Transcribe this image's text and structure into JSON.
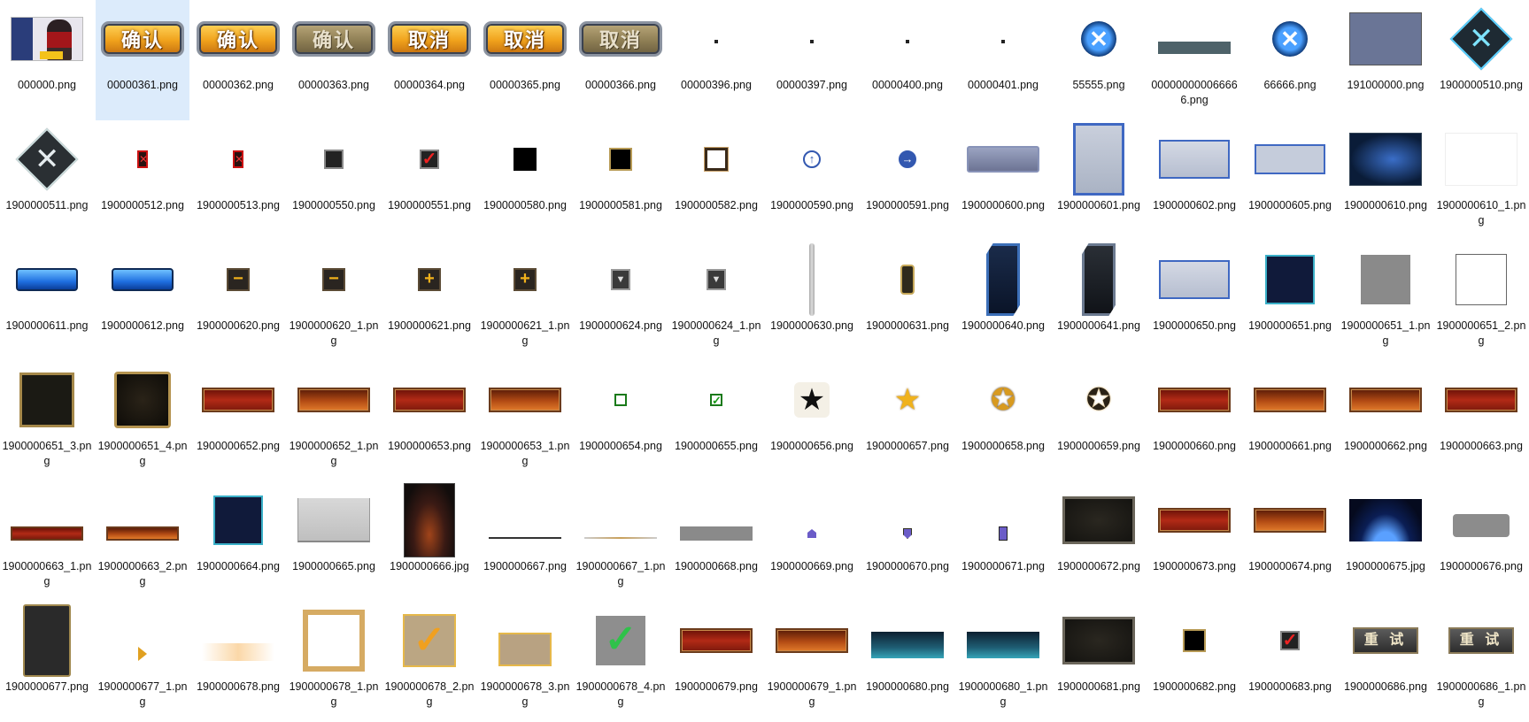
{
  "selected_index": 1,
  "files": [
    {
      "name": "000000.png",
      "icon": "character-avatar"
    },
    {
      "name": "00000361.png",
      "icon": "confirm-button-gold",
      "text": "确认"
    },
    {
      "name": "00000362.png",
      "icon": "confirm-button-gold",
      "text": "确认"
    },
    {
      "name": "00000363.png",
      "icon": "confirm-button-disabled",
      "text": "确认"
    },
    {
      "name": "00000364.png",
      "icon": "cancel-button-gold",
      "text": "取消"
    },
    {
      "name": "00000365.png",
      "icon": "cancel-button-gold",
      "text": "取消"
    },
    {
      "name": "00000366.png",
      "icon": "cancel-button-disabled",
      "text": "取消"
    },
    {
      "name": "00000396.png",
      "icon": "tiny-dot"
    },
    {
      "name": "00000397.png",
      "icon": "tiny-dot"
    },
    {
      "name": "00000400.png",
      "icon": "tiny-dot"
    },
    {
      "name": "00000401.png",
      "icon": "tiny-dot"
    },
    {
      "name": "55555.png",
      "icon": "blue-close-icon"
    },
    {
      "name": "000000000066666.png",
      "icon": "slate-bar"
    },
    {
      "name": "66666.png",
      "icon": "blue-close-icon"
    },
    {
      "name": "191000000.png",
      "icon": "slate-panel"
    },
    {
      "name": "1900000510.png",
      "icon": "diamond-close-icon"
    },
    {
      "name": "1900000511.png",
      "icon": "diamond-close-dark-icon"
    },
    {
      "name": "1900000512.png",
      "icon": "red-x-small"
    },
    {
      "name": "1900000513.png",
      "icon": "red-x-small"
    },
    {
      "name": "1900000550.png",
      "icon": "checkbox-empty"
    },
    {
      "name": "1900000551.png",
      "icon": "checkbox-checked-red"
    },
    {
      "name": "1900000580.png",
      "icon": "black-square"
    },
    {
      "name": "1900000581.png",
      "icon": "black-square-gold"
    },
    {
      "name": "1900000582.png",
      "icon": "white-square-frame"
    },
    {
      "name": "1900000590.png",
      "icon": "arrow-up-circle-icon"
    },
    {
      "name": "1900000591.png",
      "icon": "arrow-right-circle-icon"
    },
    {
      "name": "1900000600.png",
      "icon": "slate-bevel-bar"
    },
    {
      "name": "1900000601.png",
      "icon": "light-panel-tall"
    },
    {
      "name": "1900000602.png",
      "icon": "light-panel"
    },
    {
      "name": "1900000605.png",
      "icon": "light-panel-flat"
    },
    {
      "name": "1900000610.png",
      "icon": "blue-tech-panel"
    },
    {
      "name": "1900000610_1.png",
      "icon": "white-blank"
    },
    {
      "name": "1900000611.png",
      "icon": "blue-button-bar"
    },
    {
      "name": "1900000612.png",
      "icon": "blue-button-bar"
    },
    {
      "name": "1900000620.png",
      "icon": "minus-button-icon"
    },
    {
      "name": "1900000620_1.png",
      "icon": "minus-button-icon"
    },
    {
      "name": "1900000621.png",
      "icon": "plus-button-icon"
    },
    {
      "name": "1900000621_1.png",
      "icon": "plus-button-icon"
    },
    {
      "name": "1900000624.png",
      "icon": "down-arrow-box-icon"
    },
    {
      "name": "1900000624_1.png",
      "icon": "down-arrow-box-icon"
    },
    {
      "name": "1900000630.png",
      "icon": "scroll-track"
    },
    {
      "name": "1900000631.png",
      "icon": "scroll-thumb"
    },
    {
      "name": "1900000640.png",
      "icon": "dark-blue-tall-frame"
    },
    {
      "name": "1900000641.png",
      "icon": "dark-tall-frame"
    },
    {
      "name": "1900000650.png",
      "icon": "light-panel"
    },
    {
      "name": "1900000651.png",
      "icon": "navy-square"
    },
    {
      "name": "1900000651_1.png",
      "icon": "grey-square"
    },
    {
      "name": "1900000651_2.png",
      "icon": "white-square"
    },
    {
      "name": "1900000651_3.png",
      "icon": "dark-gold-frame"
    },
    {
      "name": "1900000651_4.png",
      "icon": "ornate-dark-frame"
    },
    {
      "name": "1900000652.png",
      "icon": "red-bar"
    },
    {
      "name": "1900000652_1.png",
      "icon": "orange-bar"
    },
    {
      "name": "1900000653.png",
      "icon": "red-bar"
    },
    {
      "name": "1900000653_1.png",
      "icon": "orange-bar"
    },
    {
      "name": "1900000654.png",
      "icon": "green-checkbox-empty"
    },
    {
      "name": "1900000655.png",
      "icon": "green-checkbox-checked"
    },
    {
      "name": "1900000656.png",
      "icon": "black-star-icon"
    },
    {
      "name": "1900000657.png",
      "icon": "gold-star-icon"
    },
    {
      "name": "1900000658.png",
      "icon": "gold-star-badge-icon"
    },
    {
      "name": "1900000659.png",
      "icon": "dark-star-badge-icon"
    },
    {
      "name": "1900000660.png",
      "icon": "red-bar"
    },
    {
      "name": "1900000661.png",
      "icon": "orange-bar"
    },
    {
      "name": "1900000662.png",
      "icon": "orange-bar"
    },
    {
      "name": "1900000663.png",
      "icon": "red-bar"
    },
    {
      "name": "1900000663_1.png",
      "icon": "red-thin-bar"
    },
    {
      "name": "1900000663_2.png",
      "icon": "orange-thin-bar"
    },
    {
      "name": "1900000664.png",
      "icon": "navy-square"
    },
    {
      "name": "1900000665.png",
      "icon": "grey-gradient-panel"
    },
    {
      "name": "1900000666.jpg",
      "icon": "dark-space-portrait"
    },
    {
      "name": "1900000667.png",
      "icon": "thin-line"
    },
    {
      "name": "1900000667_1.png",
      "icon": "thin-line-gold"
    },
    {
      "name": "1900000668.png",
      "icon": "grey-bar"
    },
    {
      "name": "1900000669.png",
      "icon": "tiny-pentagon-icon"
    },
    {
      "name": "1900000670.png",
      "icon": "tiny-shield-icon"
    },
    {
      "name": "1900000671.png",
      "icon": "tiny-purple-block"
    },
    {
      "name": "1900000672.png",
      "icon": "dark-metal-panel"
    },
    {
      "name": "1900000673.png",
      "icon": "red-bar"
    },
    {
      "name": "1900000674.png",
      "icon": "orange-bar"
    },
    {
      "name": "1900000675.jpg",
      "icon": "space-earth-image"
    },
    {
      "name": "1900000676.png",
      "icon": "grey-rounded-bar"
    },
    {
      "name": "1900000677.png",
      "icon": "dark-tall-card"
    },
    {
      "name": "1900000677_1.png",
      "icon": "gold-arrow-right-icon"
    },
    {
      "name": "1900000678.png",
      "icon": "cream-gradient-bar"
    },
    {
      "name": "1900000678_1.png",
      "icon": "gold-square-frame"
    },
    {
      "name": "1900000678_2.png",
      "icon": "tan-checkbox-checked"
    },
    {
      "name": "1900000678_3.png",
      "icon": "tan-box"
    },
    {
      "name": "1900000678_4.png",
      "icon": "grey-checkbox-green-check"
    },
    {
      "name": "1900000679.png",
      "icon": "red-bar"
    },
    {
      "name": "1900000679_1.png",
      "icon": "orange-bar"
    },
    {
      "name": "1900000680.png",
      "icon": "teal-gradient-bar"
    },
    {
      "name": "1900000680_1.png",
      "icon": "teal-gradient-bar"
    },
    {
      "name": "1900000681.png",
      "icon": "dark-metal-panel"
    },
    {
      "name": "1900000682.png",
      "icon": "black-square-gold"
    },
    {
      "name": "1900000683.png",
      "icon": "checkbox-checked-red"
    },
    {
      "name": "1900000686.png",
      "icon": "retry-stone-button",
      "text": "重 试"
    },
    {
      "name": "1900000686_1.png",
      "icon": "retry-stone-button",
      "text": "重 试"
    }
  ]
}
